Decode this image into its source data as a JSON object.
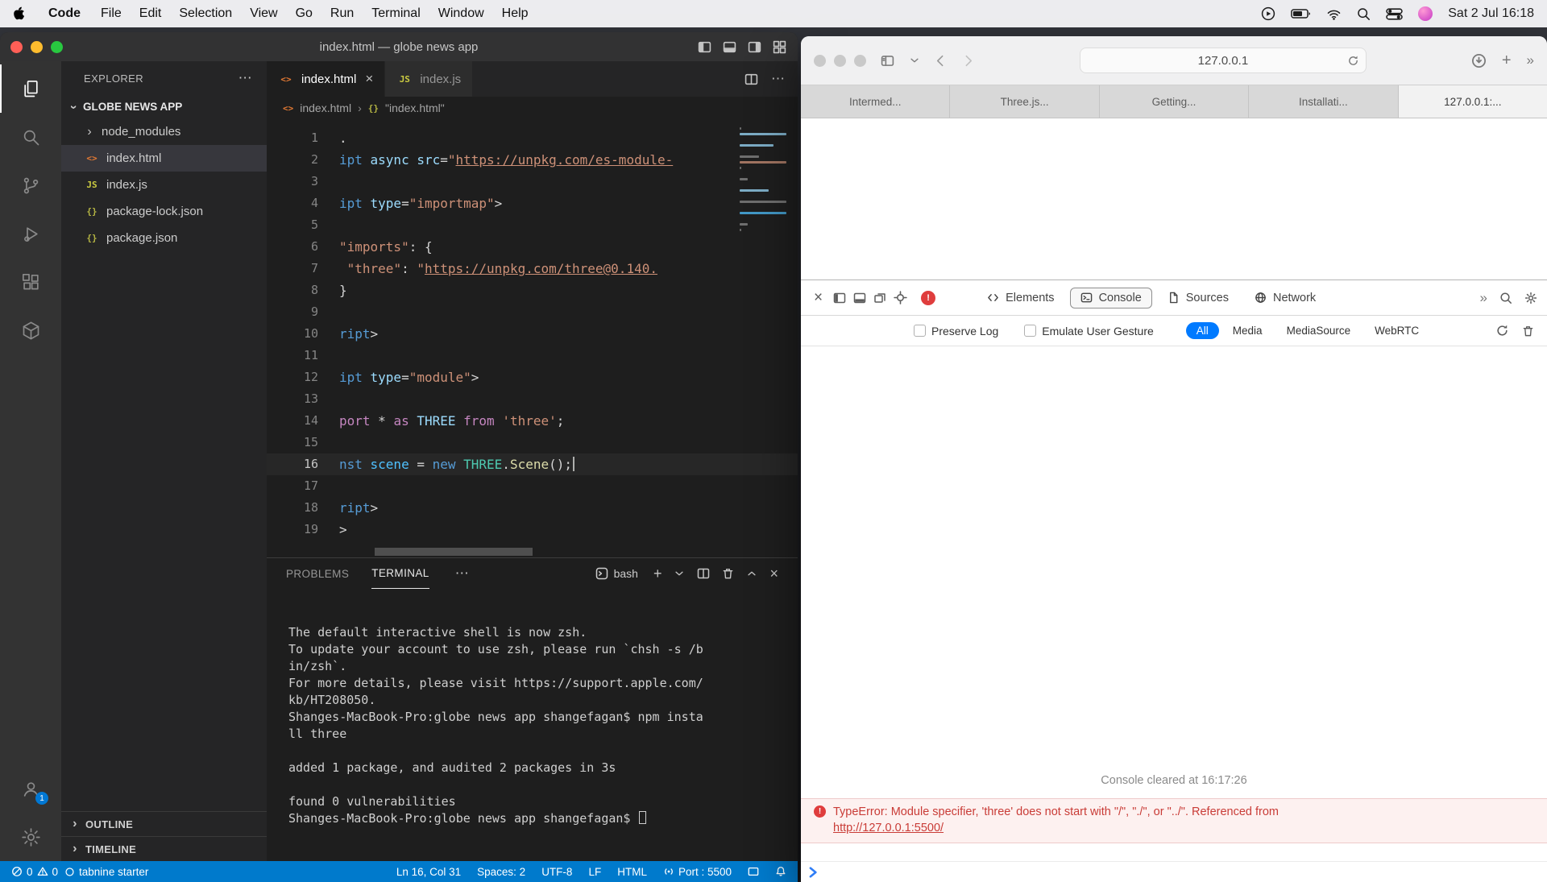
{
  "colors": {
    "accent-blue": "#007aff",
    "status-bar-blue": "#007acc",
    "error-red": "#c93c37",
    "error-bg": "#fdf1f0"
  },
  "icons": {
    "close": "×",
    "plus": "+",
    "more_h": "⋯",
    "chevron_right": "›",
    "overflow": "»",
    "bang": "!"
  },
  "menubar": {
    "app_menu": "Code",
    "menus": [
      "File",
      "Edit",
      "Selection",
      "View",
      "Go",
      "Run",
      "Terminal",
      "Window",
      "Help"
    ],
    "clock": "Sat 2 Jul 16:18"
  },
  "vscode": {
    "window_title": "index.html — globe news app",
    "explorer": {
      "header": "EXPLORER",
      "section_title": "GLOBE NEWS APP",
      "files": [
        {
          "name": "node_modules",
          "type": "folder"
        },
        {
          "name": "index.html",
          "type": "html",
          "selected": true
        },
        {
          "name": "index.js",
          "type": "js"
        },
        {
          "name": "package-lock.json",
          "type": "json"
        },
        {
          "name": "package.json",
          "type": "json"
        }
      ],
      "outline_label": "OUTLINE",
      "timeline_label": "TIMELINE"
    },
    "editor": {
      "tabs": [
        {
          "label": "index.html",
          "active": true
        },
        {
          "label": "index.js",
          "active": false
        }
      ],
      "breadcrumb": {
        "file": "index.html",
        "symbol": "\"index.html\""
      },
      "active_line": 16,
      "lines": [
        {
          "n": 1,
          "tokens": [
            [
              ".",
              "pn"
            ]
          ]
        },
        {
          "n": 2,
          "tokens": [
            [
              "ipt ",
              "tag"
            ],
            [
              "async ",
              "attr"
            ],
            [
              "src",
              "attr"
            ],
            [
              "=",
              "pn"
            ],
            [
              "\"",
              "str"
            ],
            [
              "https://unpkg.com/es-module-",
              "stru"
            ]
          ]
        },
        {
          "n": 3,
          "tokens": []
        },
        {
          "n": 4,
          "tokens": [
            [
              "ipt ",
              "tag"
            ],
            [
              "type",
              "attr"
            ],
            [
              "=",
              "pn"
            ],
            [
              "\"importmap\"",
              "str"
            ],
            [
              ">",
              "pn"
            ]
          ]
        },
        {
          "n": 5,
          "tokens": []
        },
        {
          "n": 6,
          "tokens": [
            [
              "\"imports\"",
              "str"
            ],
            [
              ": {",
              "pn"
            ]
          ]
        },
        {
          "n": 7,
          "tokens": [
            [
              " ",
              "pn"
            ],
            [
              "\"three\"",
              "str"
            ],
            [
              ": ",
              "pn"
            ],
            [
              "\"",
              "str"
            ],
            [
              "https://unpkg.com/three@0.140.",
              "stru"
            ]
          ]
        },
        {
          "n": 8,
          "tokens": [
            [
              "}",
              "pn"
            ]
          ]
        },
        {
          "n": 9,
          "tokens": []
        },
        {
          "n": 10,
          "tokens": [
            [
              "ript",
              "tag"
            ],
            [
              ">",
              "pn"
            ]
          ]
        },
        {
          "n": 11,
          "tokens": []
        },
        {
          "n": 12,
          "tokens": [
            [
              "ipt ",
              "tag"
            ],
            [
              "type",
              "attr"
            ],
            [
              "=",
              "pn"
            ],
            [
              "\"module\"",
              "str"
            ],
            [
              ">",
              "pn"
            ]
          ]
        },
        {
          "n": 13,
          "tokens": []
        },
        {
          "n": 14,
          "tokens": [
            [
              "port ",
              "kw"
            ],
            [
              "* ",
              "pn"
            ],
            [
              "as ",
              "kw"
            ],
            [
              "THREE ",
              "var"
            ],
            [
              "from ",
              "kw"
            ],
            [
              "'three'",
              "str"
            ],
            [
              ";",
              "pn"
            ]
          ]
        },
        {
          "n": 15,
          "tokens": []
        },
        {
          "n": 16,
          "tokens": [
            [
              "nst ",
              "kw2"
            ],
            [
              "scene ",
              "var2"
            ],
            [
              "= ",
              "pn"
            ],
            [
              "new ",
              "kw2"
            ],
            [
              "THREE",
              "cls"
            ],
            [
              ".",
              "pn"
            ],
            [
              "Scene",
              "fn"
            ],
            [
              "();",
              "pn"
            ]
          ]
        },
        {
          "n": 17,
          "tokens": []
        },
        {
          "n": 18,
          "tokens": [
            [
              "ript",
              "tag"
            ],
            [
              ">",
              "pn"
            ]
          ]
        },
        {
          "n": 19,
          "tokens": [
            [
              ">",
              "pn"
            ]
          ]
        }
      ]
    },
    "panel": {
      "tabs": [
        {
          "label": "PROBLEMS",
          "active": false
        },
        {
          "label": "TERMINAL",
          "active": true
        }
      ],
      "shell_label": "bash",
      "terminal_lines": [
        "The default interactive shell is now zsh.",
        "To update your account to use zsh, please run `chsh -s /b",
        "in/zsh`.",
        "For more details, please visit https://support.apple.com/",
        "kb/HT208050.",
        "Shanges-MacBook-Pro:globe news app shangefagan$ npm insta",
        "ll three",
        "",
        "added 1 package, and audited 2 packages in 3s",
        "",
        "found 0 vulnerabilities",
        "Shanges-MacBook-Pro:globe news app shangefagan$ "
      ],
      "cursor_on_last_line": true
    },
    "status_bar": {
      "errors": "0",
      "warnings": "0",
      "tabnine": "tabnine starter",
      "line_col": "Ln 16, Col 31",
      "indent": "Spaces: 2",
      "encoding": "UTF-8",
      "eol": "LF",
      "language": "HTML",
      "port": "Port : 5500"
    }
  },
  "safari": {
    "address": "127.0.0.1",
    "tabs": [
      {
        "label": "Intermed...",
        "active": false
      },
      {
        "label": "Three.js...",
        "active": false
      },
      {
        "label": "Getting...",
        "active": false
      },
      {
        "label": "Installati...",
        "active": false
      },
      {
        "label": "127.0.0.1:...",
        "active": true
      }
    ],
    "devtools": {
      "tabs": [
        "Elements",
        "Console",
        "Sources",
        "Network"
      ],
      "active_tab": "Console",
      "preserve_log_label": "Preserve Log",
      "emulate_label": "Emulate User Gesture",
      "filters": [
        "All",
        "Media",
        "MediaSource",
        "WebRTC"
      ],
      "active_filter": "All",
      "cleared_message": "Console cleared at 16:17:26",
      "error_message": "TypeError: Module specifier, 'three' does not start with \"/\", \"./\", or \"../\". Referenced from",
      "error_link": "http://127.0.0.1:5500/"
    }
  }
}
